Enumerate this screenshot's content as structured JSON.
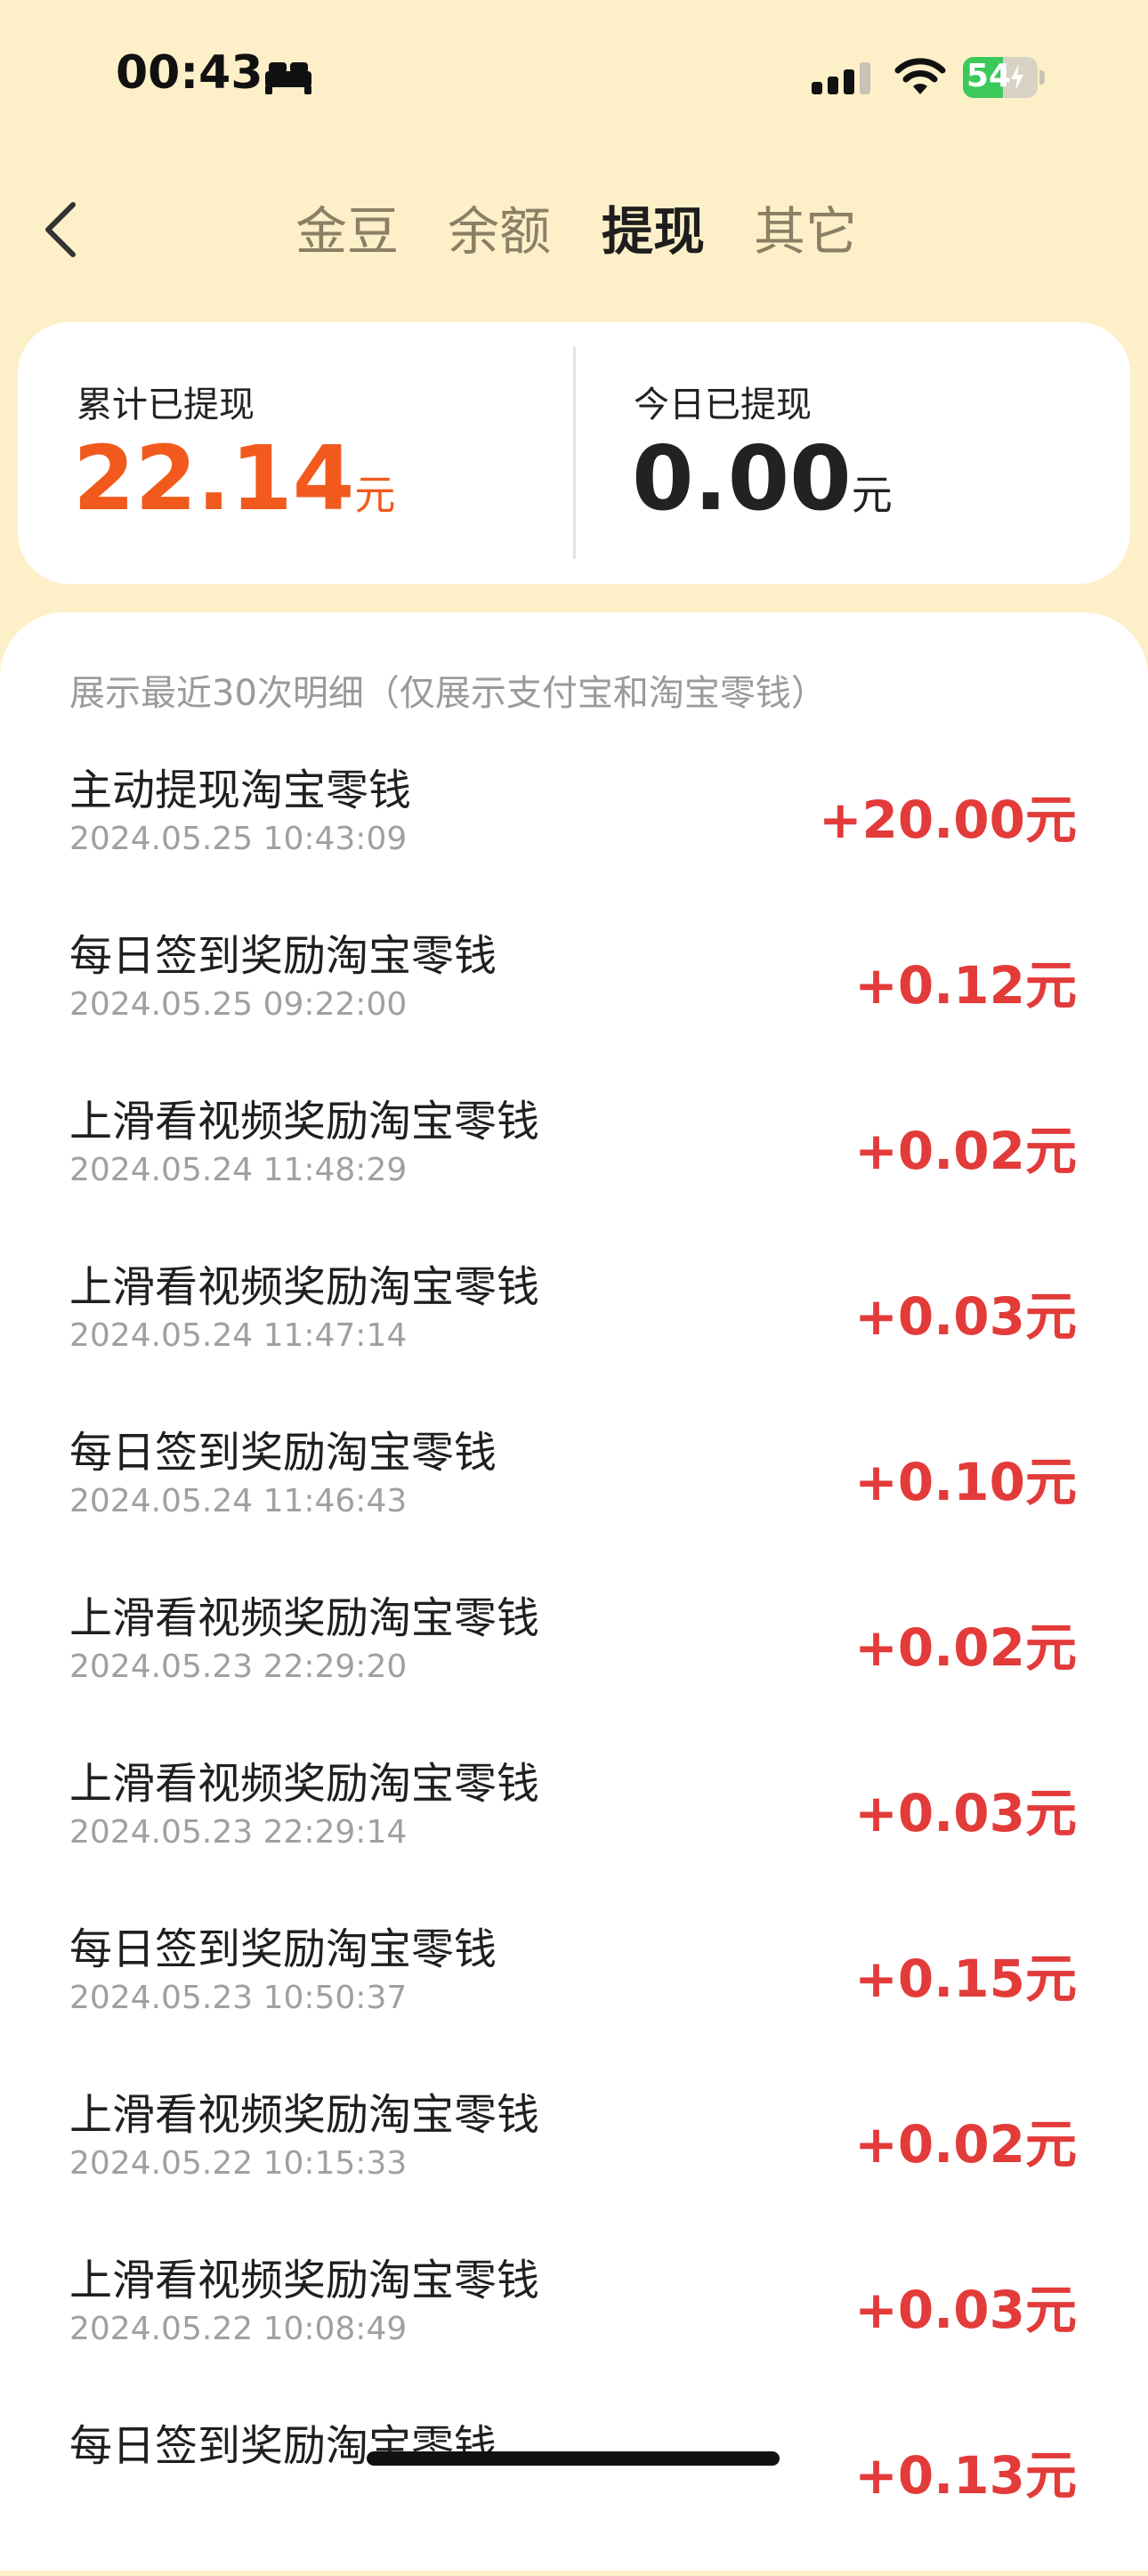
{
  "status_bar": {
    "time": "00:43",
    "battery_level": "54",
    "battery_percent": 54
  },
  "nav": {
    "tabs": [
      {
        "label": "金豆",
        "active": false
      },
      {
        "label": "余额",
        "active": false
      },
      {
        "label": "提现",
        "active": true
      },
      {
        "label": "其它",
        "active": false
      }
    ]
  },
  "summary": {
    "total": {
      "label": "累计已提现",
      "amount": "22.14",
      "unit": "元",
      "color": "#f15a1c"
    },
    "today": {
      "label": "今日已提现",
      "amount": "0.00",
      "unit": "元",
      "color": "#222222"
    }
  },
  "list": {
    "note": "展示最近30次明细（仅展示支付宝和淘宝零钱）",
    "records": [
      {
        "title": "主动提现淘宝零钱",
        "time": "2024.05.25 10:43:09",
        "amount": "+20.00元"
      },
      {
        "title": "每日签到奖励淘宝零钱",
        "time": "2024.05.25 09:22:00",
        "amount": "+0.12元"
      },
      {
        "title": "上滑看视频奖励淘宝零钱",
        "time": "2024.05.24 11:48:29",
        "amount": "+0.02元"
      },
      {
        "title": "上滑看视频奖励淘宝零钱",
        "time": "2024.05.24 11:47:14",
        "amount": "+0.03元"
      },
      {
        "title": "每日签到奖励淘宝零钱",
        "time": "2024.05.24 11:46:43",
        "amount": "+0.10元"
      },
      {
        "title": "上滑看视频奖励淘宝零钱",
        "time": "2024.05.23 22:29:20",
        "amount": "+0.02元"
      },
      {
        "title": "上滑看视频奖励淘宝零钱",
        "time": "2024.05.23 22:29:14",
        "amount": "+0.03元"
      },
      {
        "title": "每日签到奖励淘宝零钱",
        "time": "2024.05.23 10:50:37",
        "amount": "+0.15元"
      },
      {
        "title": "上滑看视频奖励淘宝零钱",
        "time": "2024.05.22 10:15:33",
        "amount": "+0.02元"
      },
      {
        "title": "上滑看视频奖励淘宝零钱",
        "time": "2024.05.22 10:08:49",
        "amount": "+0.03元"
      },
      {
        "title": "每日签到奖励淘宝零钱",
        "time": "",
        "amount": "+0.13元"
      }
    ]
  },
  "colors": {
    "page_background": "#fdf0c9",
    "amount_red": "#e23b39",
    "accent_orange": "#f15a1c"
  }
}
